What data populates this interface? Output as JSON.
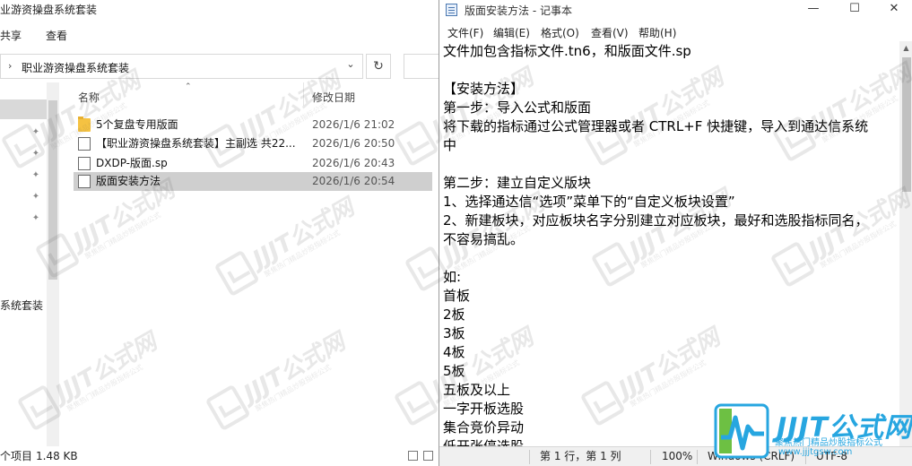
{
  "explorer": {
    "title": "业游资操盘系统套装",
    "ribbon": {
      "share": "共享",
      "view": "查看"
    },
    "address": {
      "path": "职业游资操盘系统套装"
    },
    "nav": {
      "label": "系统套装"
    },
    "columns": {
      "name": "名称",
      "modified": "修改日期"
    },
    "files": [
      {
        "name": "5个复盘专用版面",
        "date": "2026/1/6 21:02",
        "type": "folder",
        "selected": false
      },
      {
        "name": "【职业游资操盘系统套装】主副选 共22...",
        "date": "2026/1/6 20:50",
        "type": "file",
        "selected": false
      },
      {
        "name": "DXDP-版面.sp",
        "date": "2026/1/6 20:43",
        "type": "file",
        "selected": false
      },
      {
        "name": "版面安装方法",
        "date": "2026/1/6 20:54",
        "type": "file",
        "selected": true
      }
    ],
    "status": {
      "items": "个项目",
      "size": "1.48 KB"
    }
  },
  "notepad": {
    "title": "版面安装方法 - 记事本",
    "window_controls": {
      "minimize": "—",
      "maximize": "☐",
      "close": "✕"
    },
    "menu": {
      "file": "文件(F)",
      "edit": "编辑(E)",
      "format": "格式(O)",
      "view": "查看(V)",
      "help": "帮助(H)"
    },
    "lines": [
      "文件加包含指标文件.tn6，和版面文件.sp",
      "",
      "【安装方法】",
      "第一步：导入公式和版面",
      "将下载的指标通过公式管理器或者 CTRL+F 快捷键，导入到通达信系统",
      "中",
      "",
      "第二步：建立自定义版块",
      "1、选择通达信“选项”菜单下的“自定义板块设置”",
      "2、新建板块，对应板块名字分别建立对应板块，最好和选股指标同名，",
      "不容易搞乱。",
      "",
      "如:",
      "首板",
      "2板",
      "3板",
      "4板",
      "5板",
      "五板及以上",
      "一字开板选股",
      "集合竞价异动",
      "低开张停选股"
    ],
    "status": {
      "position": "第 1 行，第 1 列",
      "zoom": "100%",
      "eol": "Windows (CRLF)",
      "encoding": "UTF-8"
    }
  },
  "watermark": {
    "text": "JJJT公式网",
    "sub": "聚焦热门精品炒股指标公式"
  },
  "brand": {
    "title": "JJJT公式网",
    "subtitle": "聚焦热门精品炒股指标公式",
    "url": "www.jjjtgsw.com",
    "color": "#27a6e0"
  }
}
